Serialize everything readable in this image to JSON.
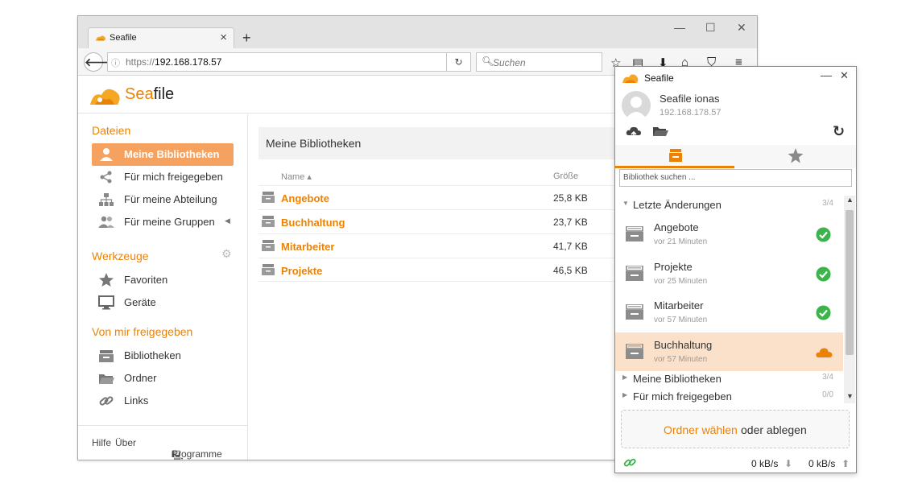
{
  "browser": {
    "tab_title": "Seafile",
    "url_prefix": "https://",
    "url_host": "192.168.178.57",
    "search_placeholder": "Suchen"
  },
  "webapp": {
    "logo_sea": "Sea",
    "logo_file": "file",
    "sidebar": {
      "files_header": "Dateien",
      "files_items": [
        {
          "label": "Meine Bibliotheken",
          "icon": "user-icon",
          "active": true
        },
        {
          "label": "Für mich freigegeben",
          "icon": "share-icon"
        },
        {
          "label": "Für meine Abteilung",
          "icon": "org-chart-icon"
        },
        {
          "label": "Für meine Gruppen",
          "icon": "group-icon"
        }
      ],
      "tools_header": "Werkzeuge",
      "tools_items": [
        {
          "label": "Favoriten",
          "icon": "star-icon"
        },
        {
          "label": "Geräte",
          "icon": "monitor-icon"
        }
      ],
      "shared_header": "Von mir freigegeben",
      "shared_items": [
        {
          "label": "Bibliotheken",
          "icon": "library-icon"
        },
        {
          "label": "Ordner",
          "icon": "folder-icon"
        },
        {
          "label": "Links",
          "icon": "link-icon"
        }
      ],
      "footer_help": "Hilfe",
      "footer_about": "Über",
      "footer_programs": "Programme"
    },
    "main": {
      "title": "Meine Bibliotheken",
      "col_name": "Name ▴",
      "col_size": "Größe",
      "libraries": [
        {
          "name": "Angebote",
          "size": "25,8 KB"
        },
        {
          "name": "Buchhaltung",
          "size": "23,7 KB"
        },
        {
          "name": "Mitarbeiter",
          "size": "41,7 KB"
        },
        {
          "name": "Projekte",
          "size": "46,5 KB"
        }
      ]
    }
  },
  "client": {
    "title": "Seafile",
    "user_name": "Seafile ionas",
    "user_host": "192.168.178.57",
    "search_placeholder": "Bibliothek suchen ...",
    "recent_label": "Letzte Änderungen",
    "recent_count": "3/4",
    "recent_items": [
      {
        "name": "Angebote",
        "time": "vor 21 Minuten",
        "status": "synced"
      },
      {
        "name": "Projekte",
        "time": "vor 25 Minuten",
        "status": "synced"
      },
      {
        "name": "Mitarbeiter",
        "time": "vor 57 Minuten",
        "status": "synced"
      },
      {
        "name": "Buchhaltung",
        "time": "vor 57 Minuten",
        "status": "cloud"
      }
    ],
    "my_libs_label": "Meine Bibliotheken",
    "my_libs_count": "3/4",
    "shared_label": "Für mich freigegeben",
    "shared_count": "0/0",
    "choose_folder": "Ordner wählen",
    "or_drop": "oder ablegen",
    "download_speed": "0 kB/s",
    "upload_speed": "0 kB/s",
    "accent": "#eb8205",
    "synced_color": "#3cb44b"
  }
}
